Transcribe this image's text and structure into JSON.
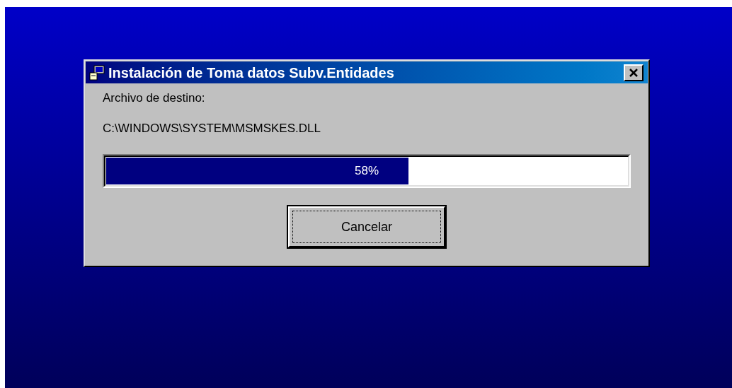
{
  "window": {
    "title": "Instalación de Toma datos Subv.Entidades"
  },
  "destination_label": "Archivo de destino:",
  "destination_path": "C:\\WINDOWS\\SYSTEM\\MSMSKES.DLL",
  "progress": {
    "level": 0.58,
    "reading": "58%"
  },
  "buttons": [
    "Cancelar"
  ]
}
